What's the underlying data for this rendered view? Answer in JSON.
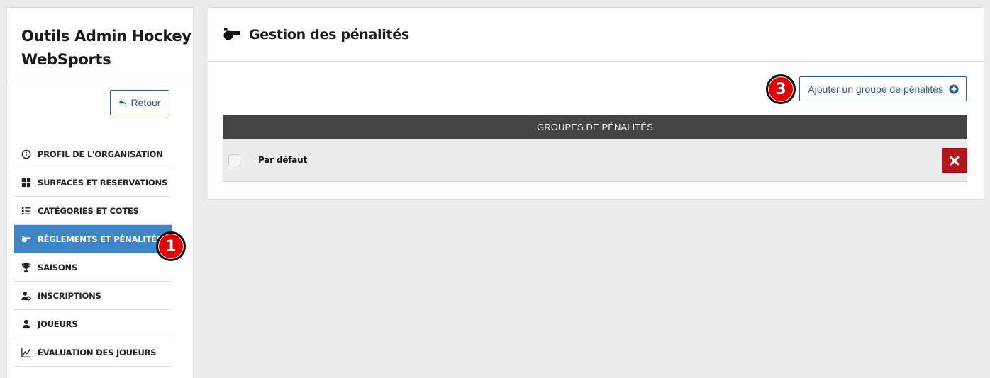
{
  "sidebar": {
    "app_title_line1": "Outils Admin Hockey",
    "app_title_line2": "WebSports",
    "back_label": "Retour",
    "items": [
      {
        "label": "PROFIL DE L'ORGANISATION",
        "icon": "info-circle-icon"
      },
      {
        "label": "SURFACES ET RÉSERVATIONS",
        "icon": "grid-icon"
      },
      {
        "label": "CATÉGORIES ET COTES",
        "icon": "list-icon"
      },
      {
        "label": "RÈGLEMENTS ET PÉNALITÉS",
        "icon": "whistle-icon",
        "active": true
      },
      {
        "label": "SAISONS",
        "icon": "trophy-icon"
      },
      {
        "label": "INSCRIPTIONS",
        "icon": "user-plus-icon"
      },
      {
        "label": "JOUEURS",
        "icon": "user-icon"
      },
      {
        "label": "ÉVALUATION DES JOUEURS",
        "icon": "chart-line-icon"
      }
    ]
  },
  "annotations": {
    "badge_1": "1",
    "badge_3": "3"
  },
  "main": {
    "title": "Gestion des pénalités",
    "title_icon": "whistle-icon",
    "add_button_label": "Ajouter un groupe de pénalités",
    "table": {
      "header": "GROUPES DE PÉNALITÉS",
      "rows": [
        {
          "label": "Par défaut"
        }
      ]
    }
  },
  "colors": {
    "accent": "#3f86c8",
    "link": "#2b5d8c",
    "danger": "#b0161c",
    "badge": "#e30000",
    "table_header": "#444444",
    "background": "#ececec"
  }
}
